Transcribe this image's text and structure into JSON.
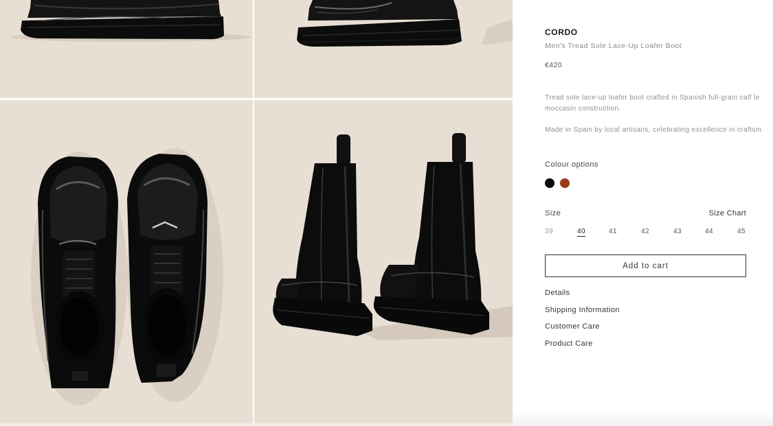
{
  "product": {
    "brand": "CORDO",
    "subtitle": "Men's Tread Sole Lace-Up Loafer Boot",
    "price": "€420",
    "description_1a": "Tread sole lace-up loafer boot crafted in Spanish full-grain calf le",
    "description_1b": "moccasin construction.",
    "description_2": "Made in Spain by local artisans, celebrating excellence in craftsm"
  },
  "colour": {
    "label": "Colour options",
    "options": [
      {
        "name": "black",
        "color": "#0b0b0b"
      },
      {
        "name": "brown",
        "color": "#9c3a1a"
      }
    ]
  },
  "size": {
    "label": "Size",
    "chart_label": "Size Chart",
    "options": [
      "39",
      "40",
      "41",
      "42",
      "43",
      "44",
      "45"
    ],
    "selected": "40",
    "unavailable": [
      "39"
    ]
  },
  "cart": {
    "label": "Add to cart"
  },
  "links": [
    "Details",
    "Shipping Information",
    "Customer Care",
    "Product Care"
  ],
  "colors": {
    "tile_background": "#e8dfd4",
    "boot": "#0d0d0d"
  }
}
